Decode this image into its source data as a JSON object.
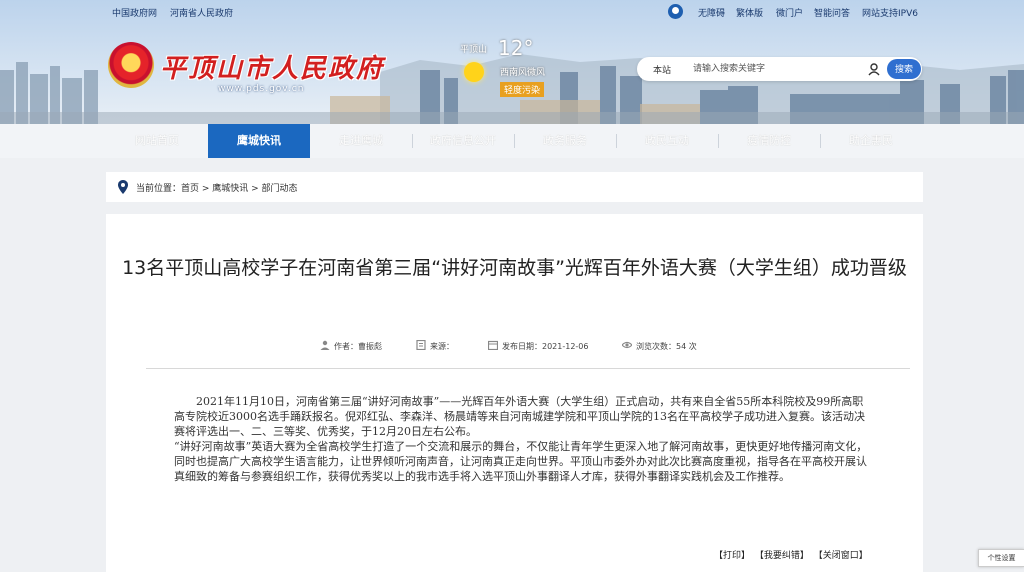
{
  "topbar": {
    "left_links": [
      "中国政府网",
      "河南省人民政府"
    ],
    "right_links": [
      "无障碍",
      "繁体版",
      "微门户",
      "智能问答",
      "网站支持IPV6"
    ]
  },
  "site": {
    "title": "平顶山市人民政府",
    "domain": "www.pds.gov.cn"
  },
  "weather": {
    "city": "平顶山",
    "temperature": "12°",
    "condition": "西南风微风",
    "aqi": "轻度污染"
  },
  "search": {
    "scope": "本站",
    "placeholder": "请输入搜索关键字",
    "button_label": "搜索"
  },
  "nav": {
    "items": [
      {
        "label": "网站首页",
        "active": false
      },
      {
        "label": "鹰城快讯",
        "active": true
      },
      {
        "label": "走进鹰城",
        "active": false
      },
      {
        "label": "政府信息公开",
        "active": false
      },
      {
        "label": "政务服务",
        "active": false
      },
      {
        "label": "政民互动",
        "active": false
      },
      {
        "label": "疫情防控",
        "active": false
      },
      {
        "label": "助企惠民",
        "active": false
      }
    ]
  },
  "breadcrumb": {
    "text": "当前位置：首页 > 鹰城快讯 > 部门动态"
  },
  "article": {
    "title": "13名平顶山高校学子在河南省第三届“讲好河南故事”光辉百年外语大赛（大学生组）成功晋级",
    "meta": {
      "author": "作者：曹振彪",
      "source": "来源：",
      "date": "发布日期：2021-12-06",
      "views": "浏览次数：54 次"
    },
    "paragraphs": [
      "2021年11月10日，河南省第三届“讲好河南故事”——光辉百年外语大赛（大学生组）正式启动，共有来自全省55所本科院校及99所高职高专院校近3000名选手踊跃报名。倪邓红弘、李森洋、杨晨靖等来自河南城建学院和平顶山学院的13名在平高校学子成功进入复赛。该活动决赛将评选出一、二、三等奖、优秀奖，于12月20日左右公布。",
      "“讲好河南故事”英语大赛为全省高校学生打造了一个交流和展示的舞台，不仅能让青年学生更深入地了解河南故事，更快更好地传播河南文化，同时也提高广大高校学生语言能力，让世界倾听河南声音，让河南真正走向世界。平顶山市委外办对此次比赛高度重视，指导各在平高校开展认真细致的筹备与参赛组织工作，获得优秀奖以上的我市选手将入选平顶山外事翻译人才库，获得外事翻译实践机会及工作推荐。"
    ],
    "actions": [
      "【打印】",
      "【我要纠错】",
      "【关闭窗口】"
    ]
  },
  "float_tab": "个性设置"
}
